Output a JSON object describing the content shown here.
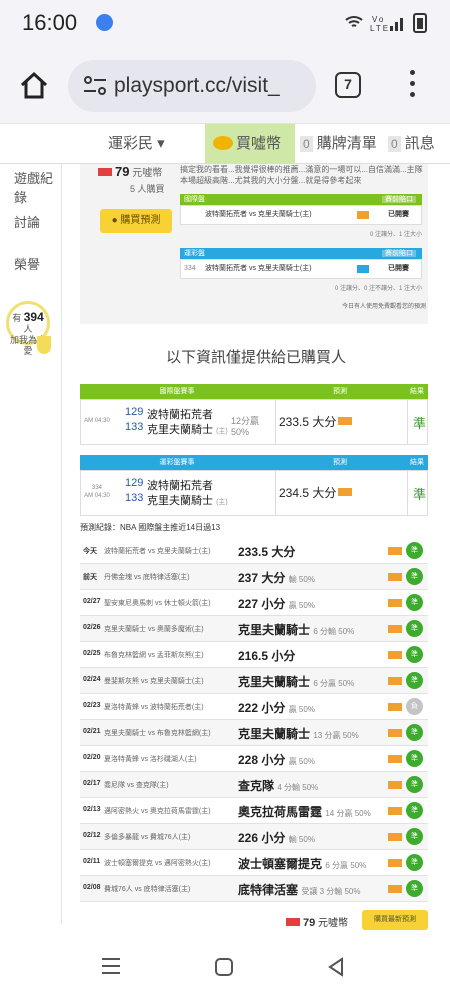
{
  "status": {
    "time": "16:00",
    "icons": "WiFi Vo LTE signal battery"
  },
  "browser": {
    "url": "playsport.cc/visit_",
    "tab_count": "7"
  },
  "nav": {
    "ranks": "運彩民 ▾",
    "buy": "買噓幣",
    "cart_zero": "0",
    "cart": "購牌清單",
    "msg_zero": "0",
    "msg": "訊息"
  },
  "sidebar": {
    "items": [
      "遊戲紀錄",
      "討論",
      "榮譽"
    ],
    "bulb_pre": "有",
    "bulb_count": "394",
    "bulb_unit": "人",
    "bulb_text": "加我為喜愛"
  },
  "preview": {
    "price_value": "79",
    "price_unit": "元噓幣",
    "buyers": "5 人購買",
    "buy_label": "購買預測",
    "text": "搞定我的看看...我覺得很棒的推薦...滿意的一場可以...自信滿滿...主隊本場超級高階...尤其我的大小分盤...就是得參考起來",
    "intl": {
      "title": "國際盤",
      "tag": "賽前賠口",
      "game_a": "波特蘭拓荒者",
      "game_b": "克里夫蘭騎士(主)",
      "status": "已開賽",
      "note": "0 注讓分、1 注大小"
    },
    "sport": {
      "title": "運彩盤",
      "tag": "賽前賠口",
      "num": "334",
      "game_a": "波特蘭拓荒者",
      "game_b": "克里夫蘭騎士(主)",
      "status": "已開賽",
      "note": "0 注讓分、0 注不讓分、1 注大小"
    },
    "footer": "今日有人使用免費觀看您的預測"
  },
  "notice": "以下資訊僅提供給已購買人",
  "intl_table": {
    "title": "國際盤賽事",
    "col_pred": "預測",
    "col_res": "結果",
    "time": "AM 04:30",
    "num_a": "129",
    "team_a": "波特蘭拓荒者",
    "num_b": "133",
    "team_b": "克里夫蘭騎士",
    "home": "(主)",
    "res_line1": "12分贏",
    "res_line2": "50%",
    "pick": "233.5 大分",
    "result": "準"
  },
  "sport_table": {
    "title": "運彩盤賽事",
    "col_pred": "預測",
    "col_res": "結果",
    "code": "334",
    "time": "AM 04:30",
    "num_a": "129",
    "team_a": "波特蘭拓荒者",
    "num_b": "133",
    "team_b": "克里夫蘭騎士",
    "home": "(主)",
    "pick": "234.5 大分",
    "result": "準"
  },
  "record_title": "預測紀錄：NBA 國際盤主推近14日過13",
  "records": [
    {
      "date": "今天",
      "game": "波特蘭拓荒者 vs 克里夫蘭騎士(主)",
      "pick": "233.5 大分",
      "detail": "",
      "result": "準"
    },
    {
      "date": "前天",
      "game": "丹佛金塊 vs 底特律活塞(主)",
      "pick": "237 大分",
      "detail": "輸 50%",
      "result": "準"
    },
    {
      "date": "02/27",
      "game": "聖安東尼奧馬刺 vs 休士頓火箭(主)",
      "pick": "227 小分",
      "detail": "贏 50%",
      "result": "準"
    },
    {
      "date": "02/26",
      "game": "克里夫蘭騎士 vs 奧蘭多魔術(主)",
      "pick": "克里夫蘭騎士",
      "detail": "6 分輸 50%",
      "result": "準"
    },
    {
      "date": "02/25",
      "game": "布魯克林籃網 vs 孟菲斯灰熊(主)",
      "pick": "216.5 小分",
      "detail": "",
      "result": "準"
    },
    {
      "date": "02/24",
      "game": "曼斐斯灰熊 vs 克里夫蘭騎士(主)",
      "pick": "克里夫蘭騎士",
      "detail": "6 分贏 50%",
      "result": "準"
    },
    {
      "date": "02/23",
      "game": "夏洛特黃蜂 vs 波特蘭拓荒者(主)",
      "pick": "222 小分",
      "detail": "贏 50%",
      "result": "負"
    },
    {
      "date": "02/21",
      "game": "克里夫蘭騎士 vs 布魯克林籃網(主)",
      "pick": "克里夫蘭騎士",
      "detail": "13 分贏 50%",
      "result": "準"
    },
    {
      "date": "02/20",
      "game": "夏洛特黃蜂 vs 洛杉磯湖人(主)",
      "pick": "228 小分",
      "detail": "贏 50%",
      "result": "準"
    },
    {
      "date": "02/17",
      "game": "喬尼隊 vs 查克隊(主)",
      "pick": "查克隊",
      "detail": "4 分輸 50%",
      "result": "準"
    },
    {
      "date": "02/13",
      "game": "邁阿密熱火 vs 奧克拉荷馬雷霆(主)",
      "pick": "奧克拉荷馬雷霆",
      "detail": "14 分贏 50%",
      "result": "準"
    },
    {
      "date": "02/12",
      "game": "多倫多暴龍 vs 費城76人(主)",
      "pick": "226 小分",
      "detail": "輸 50%",
      "result": "準"
    },
    {
      "date": "02/11",
      "game": "波士頓塞爾提克 vs 邁阿密熱火(主)",
      "pick": "波士頓塞爾提克",
      "detail": "6 分贏 50%",
      "result": "準"
    },
    {
      "date": "02/08",
      "game": "費城76人 vs 底特律活塞(主)",
      "pick": "底特律活塞",
      "detail": "受讓 3 分輸 50%",
      "result": "準"
    }
  ],
  "bottom": {
    "price_value": "79",
    "price_unit": "元噓幣",
    "buy_label": "購買最新預測"
  },
  "colors": {
    "green": "#7bc220",
    "blue": "#29a8e0",
    "yellow": "#f8d234",
    "ok": "#3cab2e"
  }
}
